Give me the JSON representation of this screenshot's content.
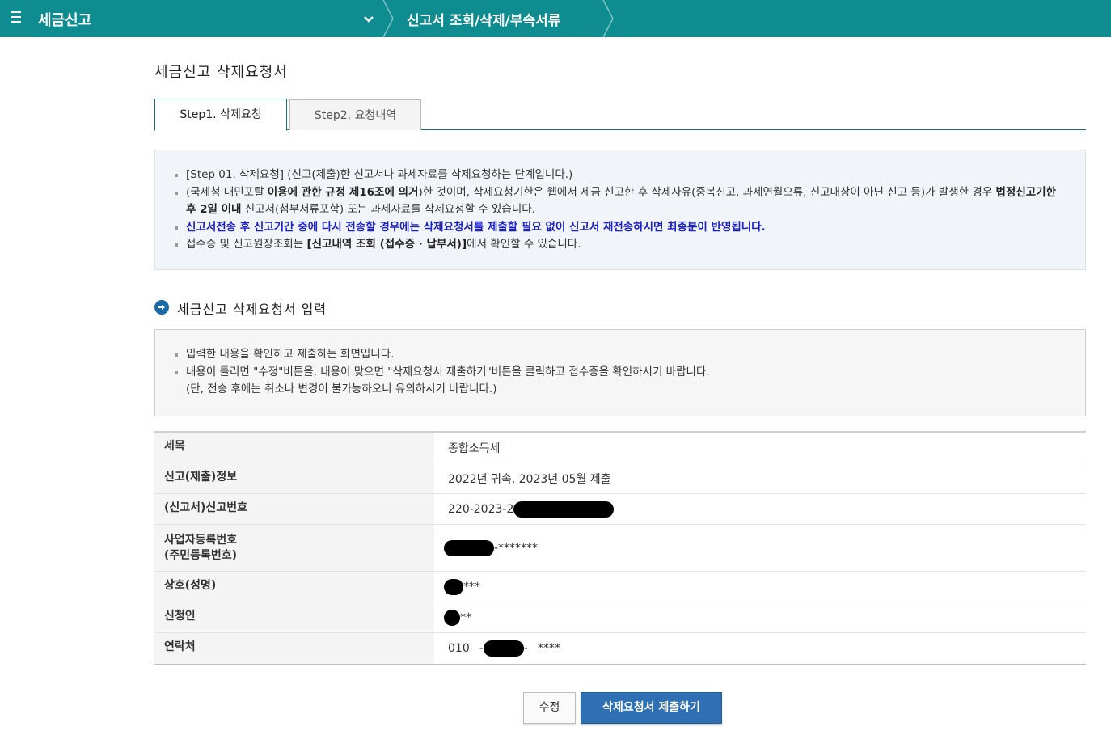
{
  "header": {
    "app_title": "세금신고",
    "breadcrumb": "신고서 조회/삭제/부속서류",
    "icons": [
      "menu-icon",
      "chevron-down-icon"
    ]
  },
  "page_title": "세금신고 삭제요청서",
  "tabs": [
    {
      "label": "Step1. 삭제요청",
      "active": true
    },
    {
      "label": "Step2. 요청내역",
      "active": false
    }
  ],
  "notice": {
    "item1": "[Step 01. 삭제요청] (신고(제출)한 신고서나 과세자료를 삭제요청하는 단계입니다.)",
    "item2_part1": "(국세청 대민포탈 ",
    "item2_bold1": "이용에 관한 규정 제16조에 의거",
    "item2_part2": ")한 것이며, 삭제요청기한은 웹에서 세금 신고한 후 삭제사유(중복신고, 과세연월오류, 신고대상이 아닌 신고 등)가 발생한 경우 ",
    "item2_bold2": "법정신고기한 후 2일 이내",
    "item2_part3": " 신고서(첨부서류포함) 또는 과세자료를 삭제요청할 수 있습니다.",
    "item3": "신고서전송 후 신고기간 중에 다시 전송할 경우에는 삭제요청서를 제출할 필요 없이 신고서 재전송하시면 최종분이 반영됩니다.",
    "item4_part1": "접수증 및 신고원장조회는 ",
    "item4_bold": "[신고내역 조회 (접수증 · 납부서)]",
    "item4_part2": "에서 확인할 수 있습니다."
  },
  "section_title": "세금신고 삭제요청서 입력",
  "guide": {
    "item1": "입력한 내용을 확인하고 제출하는 화면입니다.",
    "item2": "내용이 틀리면 \"수정\"버튼을, 내용이 맞으면 \"삭제요청서 제출하기\"버튼을 클릭하고 접수증을 확인하시기 바랍니다.",
    "item2_note": "(단, 전송 후에는 취소나 변경이 불가능하오니 유의하시기 바랍니다.)"
  },
  "table": {
    "tax_item_label": "세목",
    "tax_item_value": "종합소득세",
    "filing_info_label": "신고(제출)정보",
    "filing_info_value": "2022년 귀속, 2023년 05월 제출",
    "filing_no_label": "(신고서)신고번호",
    "filing_no_value": "220-2023-2",
    "reg_no_label_line1": "사업자등록번호",
    "reg_no_label_line2": "(주민등록번호)",
    "reg_no_value": "-*******",
    "trade_name_label": "상호(성명)",
    "trade_name_value": "***",
    "applicant_label": "신청인",
    "applicant_value": "**",
    "contact_label": "연락처",
    "contact_prefix": "010",
    "contact_dash1": "-",
    "contact_dash2": "-",
    "contact_suffix": "****"
  },
  "buttons": {
    "edit": "수정",
    "submit": "삭제요청서 제출하기"
  },
  "colors": {
    "header_bg": "#0e8c90",
    "notice_bg": "#f1f5fa",
    "highlight_text": "#1a1ec8",
    "submit_button": "#2f70b4"
  }
}
